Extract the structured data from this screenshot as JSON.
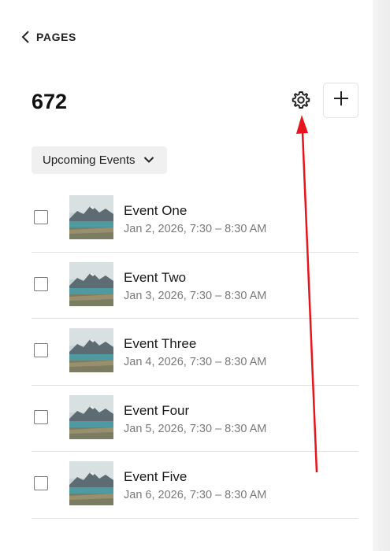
{
  "nav": {
    "back_label": "PAGES",
    "back_icon": "chevron-left-icon"
  },
  "header": {
    "title": "672",
    "settings_icon": "gear-icon",
    "add_icon": "plus-icon"
  },
  "filter": {
    "label": "Upcoming Events",
    "icon": "chevron-down-icon"
  },
  "events": [
    {
      "title": "Event One",
      "date": "Jan 2, 2026, 7:30 – 8:30 AM"
    },
    {
      "title": "Event Two",
      "date": "Jan 3, 2026, 7:30 – 8:30 AM"
    },
    {
      "title": "Event Three",
      "date": "Jan 4, 2026, 7:30 – 8:30 AM"
    },
    {
      "title": "Event Four",
      "date": "Jan 5, 2026, 7:30 – 8:30 AM"
    },
    {
      "title": "Event Five",
      "date": "Jan 6, 2026, 7:30 – 8:30 AM"
    }
  ],
  "colors": {
    "annotation_arrow": "#e8141b",
    "filter_bg": "#f0f0f0",
    "date_text": "#7a7a7a"
  }
}
